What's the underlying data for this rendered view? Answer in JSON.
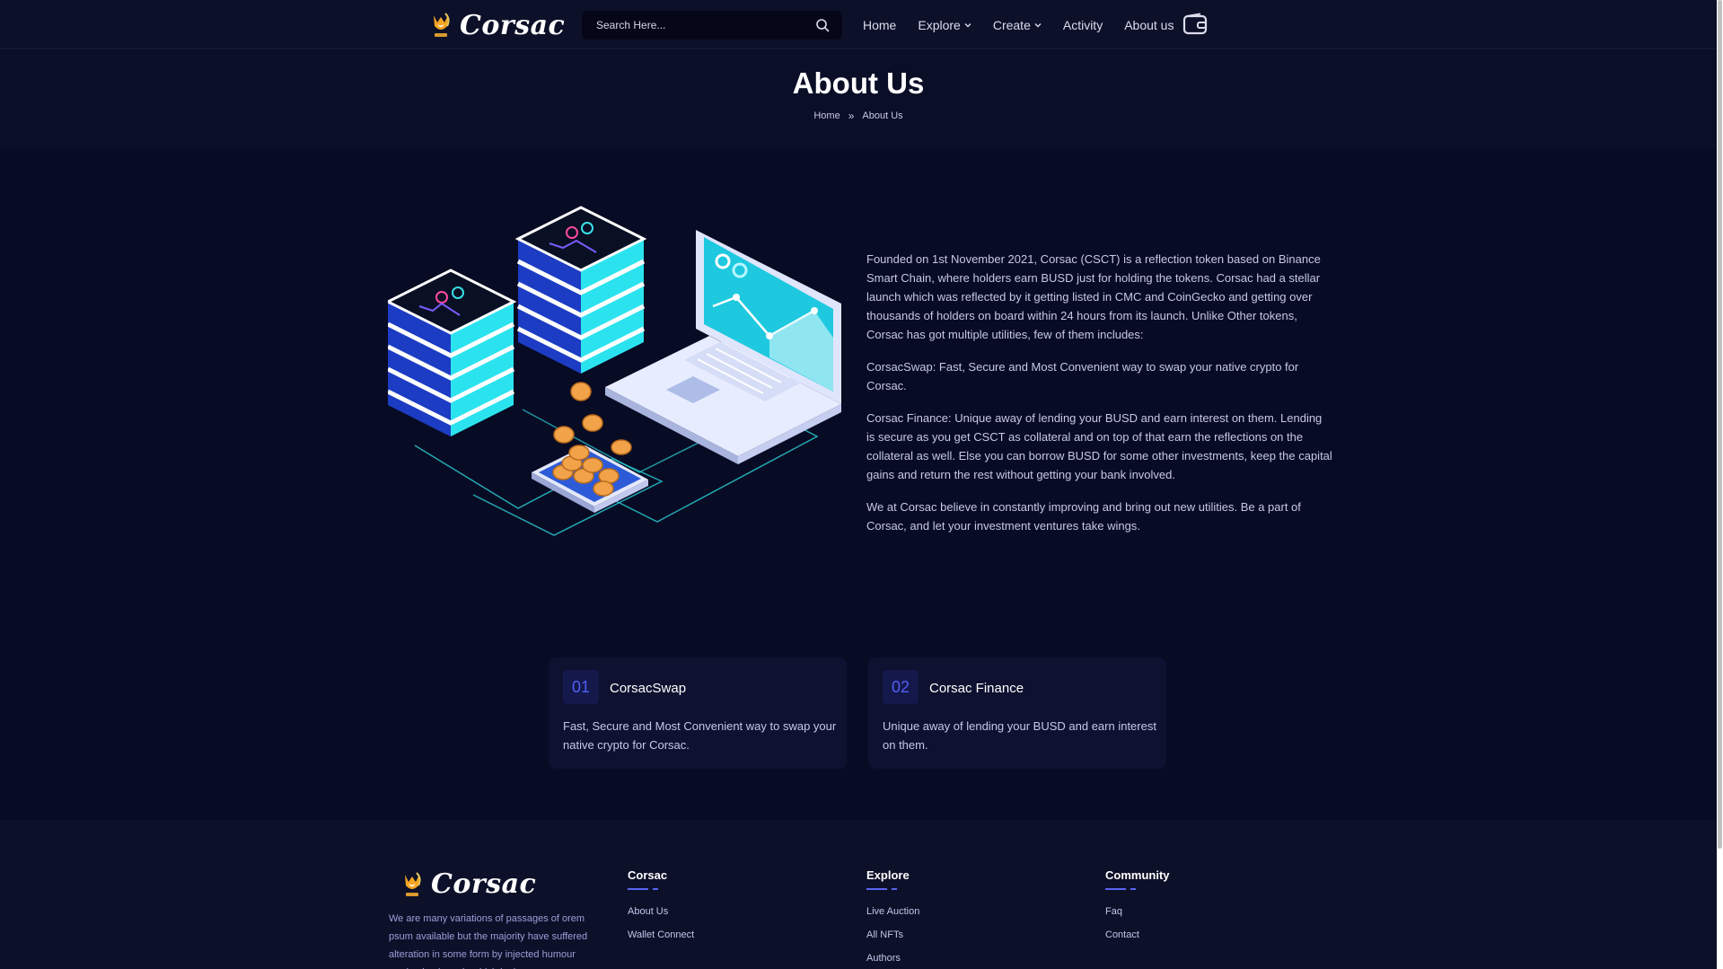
{
  "header": {
    "logo_text": "Corsac",
    "search_placeholder": "Search Here...",
    "nav": [
      {
        "label": "Home",
        "dropdown": false
      },
      {
        "label": "Explore",
        "dropdown": true
      },
      {
        "label": "Create",
        "dropdown": true
      },
      {
        "label": "Activity",
        "dropdown": false
      },
      {
        "label": "About us",
        "dropdown": false
      }
    ],
    "icons": {
      "search": "search-icon",
      "wallet": "wallet-icon",
      "chevron": "chevron-down-icon"
    }
  },
  "page_title": {
    "title": "About Us",
    "breadcrumb": {
      "home": "Home",
      "separator": "»",
      "current": "About Us"
    }
  },
  "about": {
    "paragraphs": [
      "Founded on 1st November 2021, Corsac (CSCT) is a reflection token based on Binance Smart Chain, where holders earn BUSD just for holding the tokens. Corsac had a stellar launch which was reflected by it getting listed in CMC and CoinGecko and getting over thousands of holders on board within 24 hours from its launch. Unlike Other tokens, Corsac has got multiple utilities, few of them includes:",
      "CorsacSwap: Fast, Secure and Most Convenient way to swap your native crypto for Corsac.",
      "Corsac Finance: Unique away of lending your BUSD and earn interest on them. Lending is secure as you get CSCT as collateral and on top of that earn the reflections on the collateral as well. Else you can borrow BUSD for some other investments, keep the capital gains and return the rest without getting your bank involved.",
      "We at Corsac believe in constantly improving and bring out new utilities. Be a part of Corsac, and let your investment ventures take wings."
    ]
  },
  "cards": [
    {
      "number": "01",
      "title": "CorsacSwap",
      "description": "Fast, Secure and Most Convenient way to swap your native crypto for Corsac."
    },
    {
      "number": "02",
      "title": "Corsac Finance",
      "description": "Unique away of lending your BUSD and earn interest on them."
    }
  ],
  "footer": {
    "logo_text": "Corsac",
    "about": "We are many variations of passages of orem psum available but the majority have suffered alteration in some form by injected humour randomised words which look even",
    "columns": [
      {
        "title": "Corsac",
        "links": [
          "About Us",
          "Wallet Connect"
        ]
      },
      {
        "title": "Explore",
        "links": [
          "Live Auction",
          "All NFTs",
          "Authors"
        ]
      },
      {
        "title": "Community",
        "links": [
          "Faq",
          "Contact"
        ]
      }
    ]
  },
  "colors": {
    "background": "#080b24",
    "header": "#0d1029",
    "accent": "#5864f0",
    "card": "#0e1130",
    "text": "#c6c8e6"
  }
}
